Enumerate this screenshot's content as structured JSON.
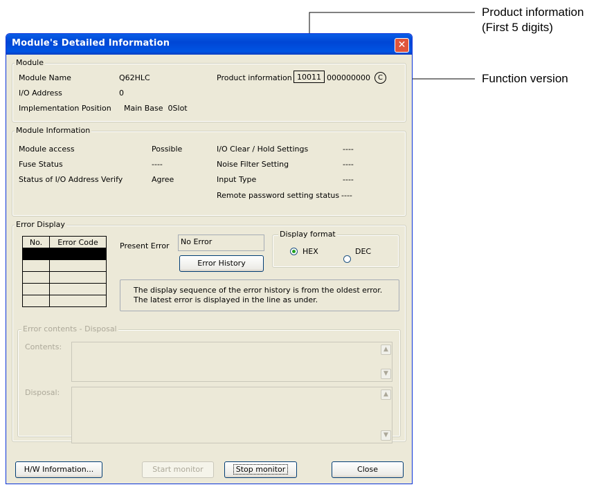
{
  "callouts": {
    "product_info_line1": "Product information",
    "product_info_line2": "(First 5 digits)",
    "function_version": "Function version"
  },
  "dialog": {
    "title": "Module's Detailed Information",
    "close_glyph": "✕",
    "module": {
      "legend": "Module",
      "name_label": "Module Name",
      "name_value": "Q62HLC",
      "io_label": "I/O Address",
      "io_value": "0",
      "impl_label": "Implementation Position",
      "impl_value": "Main Base  0Slot",
      "product_label": "Product information",
      "product_first5": "10011",
      "product_rest": "000000000",
      "function_version": "C"
    },
    "module_info": {
      "legend": "Module Information",
      "access_label": "Module access",
      "access_value": "Possible",
      "fuse_label": "Fuse Status",
      "fuse_value": "----",
      "verify_label": "Status of I/O Address Verify",
      "verify_value": "Agree",
      "ioclear_label": "I/O Clear / Hold Settings",
      "ioclear_value": "----",
      "noise_label": "Noise Filter Setting",
      "noise_value": "----",
      "input_label": "Input Type",
      "input_value": "----",
      "remote_label": "Remote password setting status",
      "remote_value": "----"
    },
    "error_display": {
      "legend": "Error Display",
      "col_no": "No.",
      "col_code": "Error Code",
      "present_label": "Present Error",
      "present_value": "No Error",
      "history_button": "Error History",
      "format_legend": "Display format",
      "hex_label": "HEX",
      "dec_label": "DEC",
      "selected_format": "HEX",
      "note_line1": "The display sequence of the error history is from the oldest error.",
      "note_line2": "The latest error is displayed in the line as under."
    },
    "error_contents": {
      "legend": "Error contents - Disposal",
      "contents_label": "Contents:",
      "disposal_label": "Disposal:"
    },
    "buttons": {
      "hw_info": "H/W Information...",
      "start_monitor": "Start monitor",
      "stop_monitor": "Stop monitor",
      "close": "Close"
    }
  },
  "colors": {
    "titlebar": "#0054e3",
    "dialog_bg": "#ece9d8",
    "close_button": "#e0553b",
    "selected_row": "#000000"
  }
}
